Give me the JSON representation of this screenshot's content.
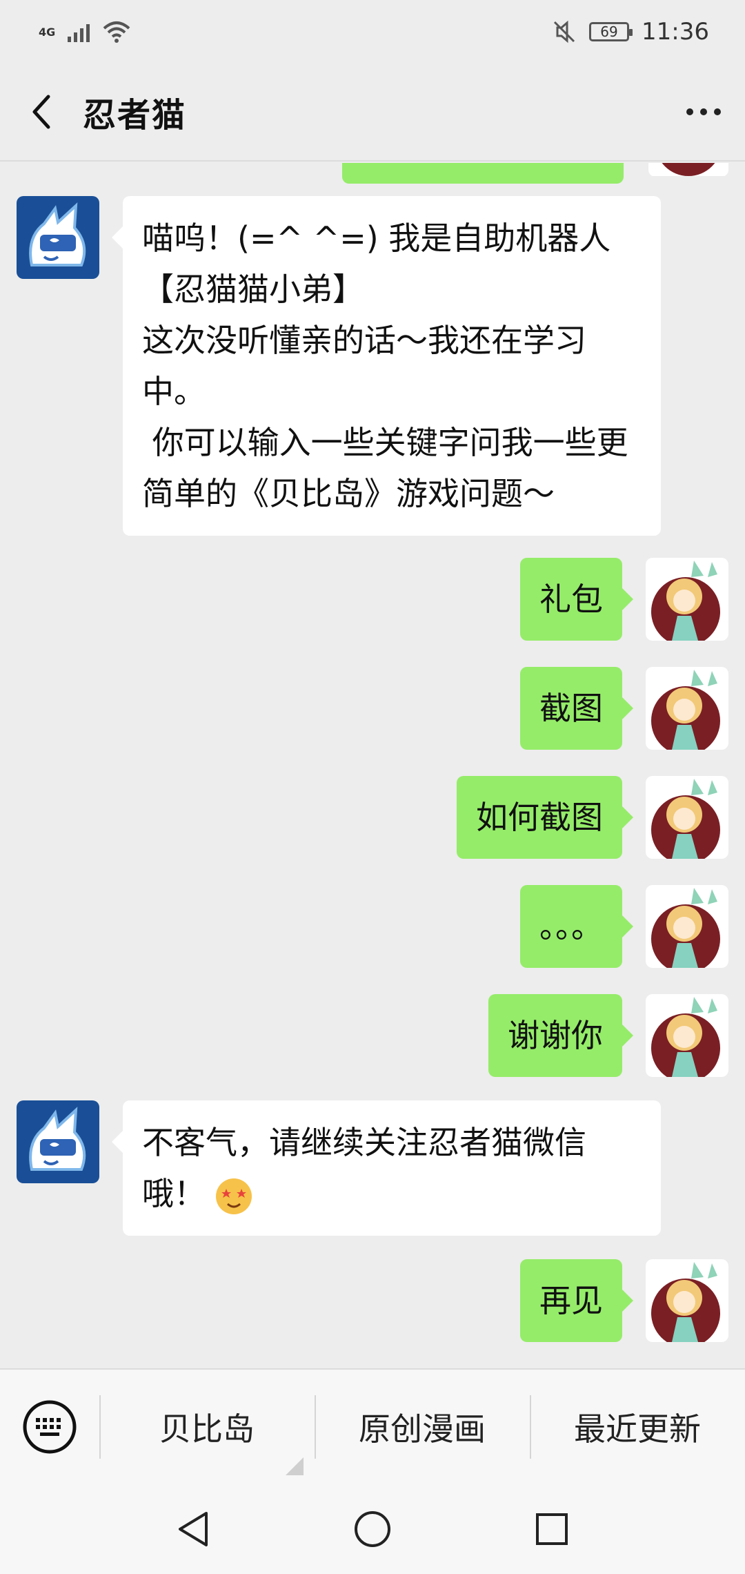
{
  "status_bar": {
    "network": "4G",
    "battery": "69",
    "time": "11:36"
  },
  "header": {
    "title": "忍者猫"
  },
  "messages": [
    {
      "from": "bot",
      "text": "喵呜！(=^ ^=) 我是自助机器人\n【忍猫猫小弟】\n这次没听懂亲的话～我还在学习中。\n 你可以输入一些关键字问我一些更简单的《贝比岛》游戏问题～"
    },
    {
      "from": "me",
      "text": "礼包"
    },
    {
      "from": "me",
      "text": "截图"
    },
    {
      "from": "me",
      "text": "如何截图"
    },
    {
      "from": "me",
      "text": "。。。"
    },
    {
      "from": "me",
      "text": "谢谢你"
    },
    {
      "from": "bot",
      "text": "不客气，请继续关注忍者猫微信哦！"
    },
    {
      "from": "me",
      "text": "再见"
    }
  ],
  "menu": {
    "items": [
      "贝比岛",
      "原创漫画",
      "最近更新"
    ]
  },
  "icons": {
    "back": "chevron-left-icon",
    "more": "more-dots-icon",
    "keyboard": "keyboard-icon",
    "emoji": "star-eyes-emoji-icon",
    "nav_back": "triangle-back-icon",
    "nav_home": "circle-home-icon",
    "nav_recents": "square-recents-icon"
  },
  "colors": {
    "outgoing_bubble": "#95ec69",
    "incoming_bubble": "#ffffff",
    "background": "#ededed"
  }
}
